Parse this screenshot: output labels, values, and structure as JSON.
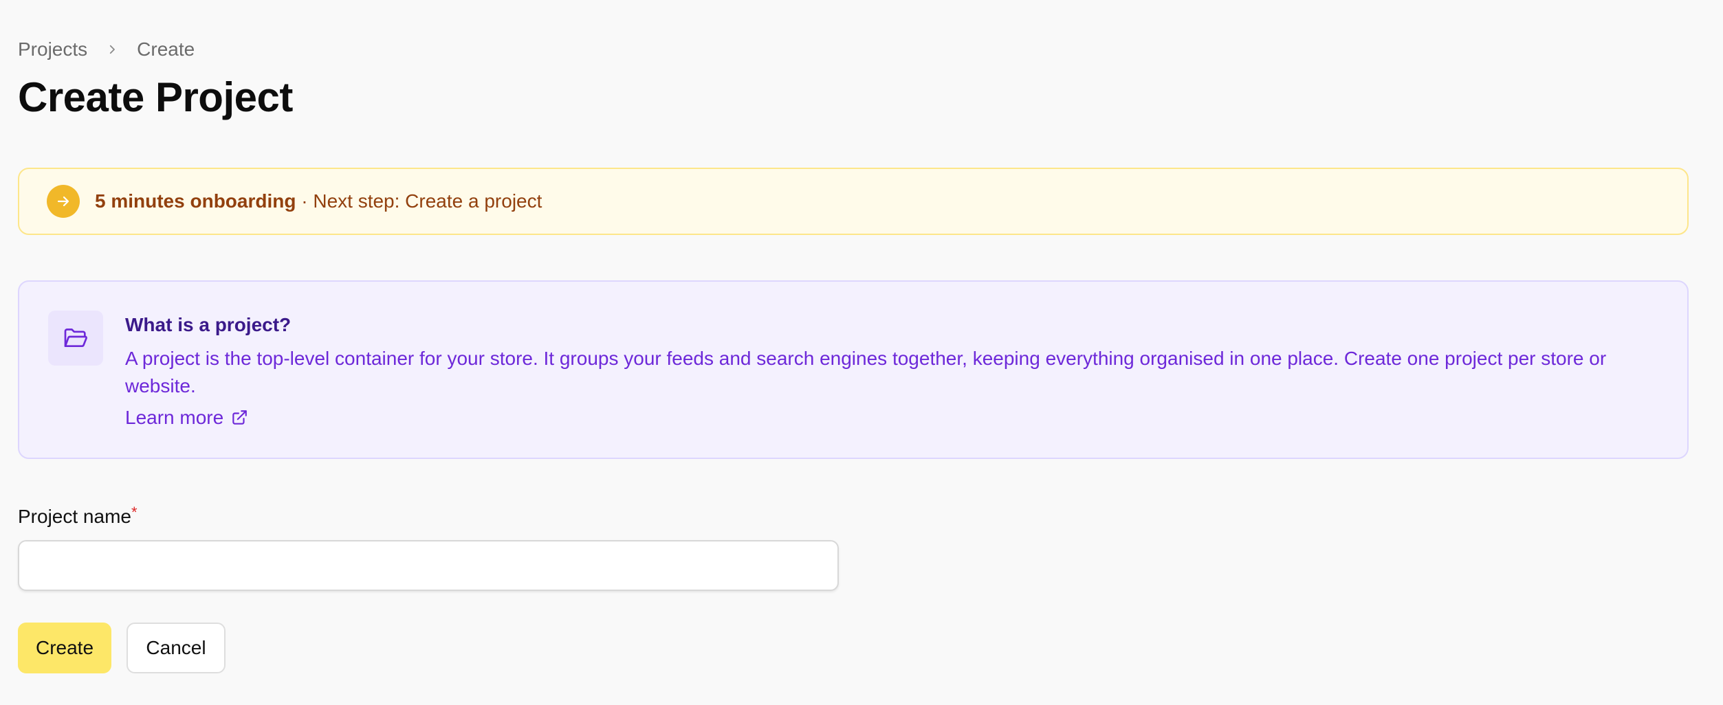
{
  "breadcrumb": {
    "items": [
      "Projects",
      "Create"
    ]
  },
  "page": {
    "title": "Create Project"
  },
  "onboarding": {
    "strong": "5 minutes onboarding",
    "rest": " · Next step: Create a project",
    "icon": "arrow-right-icon",
    "badge_color": "#f1b829"
  },
  "info": {
    "icon": "folder-open-icon",
    "title": "What is a project?",
    "body": "A project is the top-level container for your store. It groups your feeds and search engines together, keeping everything organised in one place. Create one project per store or website.",
    "link": "Learn more",
    "link_icon": "external-link-icon"
  },
  "form": {
    "project_name_label": "Project name",
    "required_mark": "*",
    "project_name_value": "",
    "project_name_placeholder": ""
  },
  "actions": {
    "create": "Create",
    "cancel": "Cancel"
  },
  "colors": {
    "accent_yellow": "#fde768",
    "info_purple": "#6d28d9",
    "banner_text": "#92400e"
  }
}
